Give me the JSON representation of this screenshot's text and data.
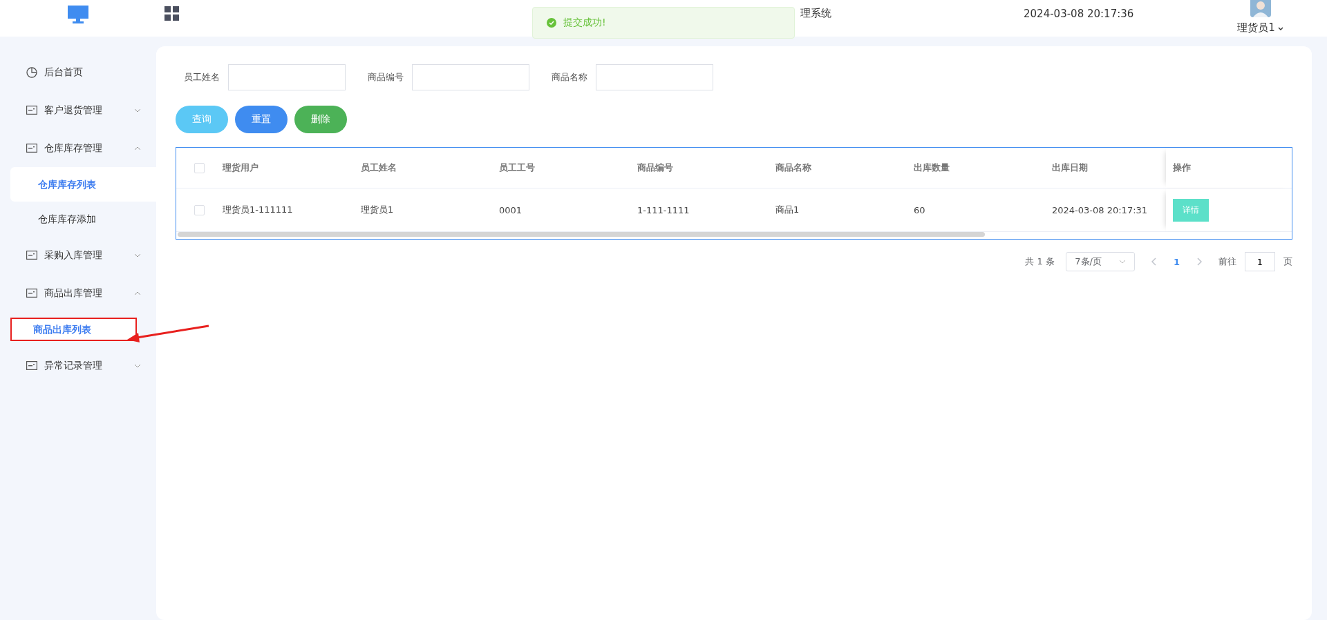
{
  "header": {
    "title_visible": "理系统",
    "datetime": "2024-03-08 20:17:36",
    "user": "理货员1"
  },
  "toast": {
    "message": "提交成功!"
  },
  "sidebar": {
    "items": [
      {
        "label": "后台首页",
        "kind": "home"
      },
      {
        "label": "客户退货管理",
        "kind": "group",
        "expanded": false
      },
      {
        "label": "仓库库存管理",
        "kind": "group",
        "expanded": true,
        "children": [
          {
            "label": "仓库库存列表",
            "selected": true
          },
          {
            "label": "仓库库存添加",
            "selected": false
          }
        ]
      },
      {
        "label": "采购入库管理",
        "kind": "group",
        "expanded": false
      },
      {
        "label": "商品出库管理",
        "kind": "group",
        "expanded": true,
        "children": [
          {
            "label": "商品出库列表",
            "selected": true,
            "highlighted": true
          }
        ]
      },
      {
        "label": "异常记录管理",
        "kind": "group",
        "expanded": false
      }
    ]
  },
  "filters": [
    {
      "label": "员工姓名"
    },
    {
      "label": "商品编号"
    },
    {
      "label": "商品名称"
    }
  ],
  "buttons": [
    {
      "label": "查询",
      "color": "#5bc8f5"
    },
    {
      "label": "重置",
      "color": "#3f8cf0"
    },
    {
      "label": "删除",
      "color": "#4cb257"
    }
  ],
  "table": {
    "all_checked": false,
    "columns": [
      "理货用户",
      "员工姓名",
      "员工工号",
      "商品编号",
      "商品名称",
      "出库数量",
      "出库日期"
    ],
    "action_column": "操作",
    "rows": [
      {
        "cells": [
          "理货员1-111111",
          "理货员1",
          "0001",
          "1-111-1111",
          "商品1",
          "60",
          "2024-03-08 20:17:31"
        ],
        "action": "详情",
        "checked": false
      }
    ]
  },
  "pagination": {
    "total": "共 1 条",
    "page_size": "7条/页",
    "current": "1",
    "goto_label": "前往",
    "goto_value": "1",
    "page_suffix": "页"
  }
}
